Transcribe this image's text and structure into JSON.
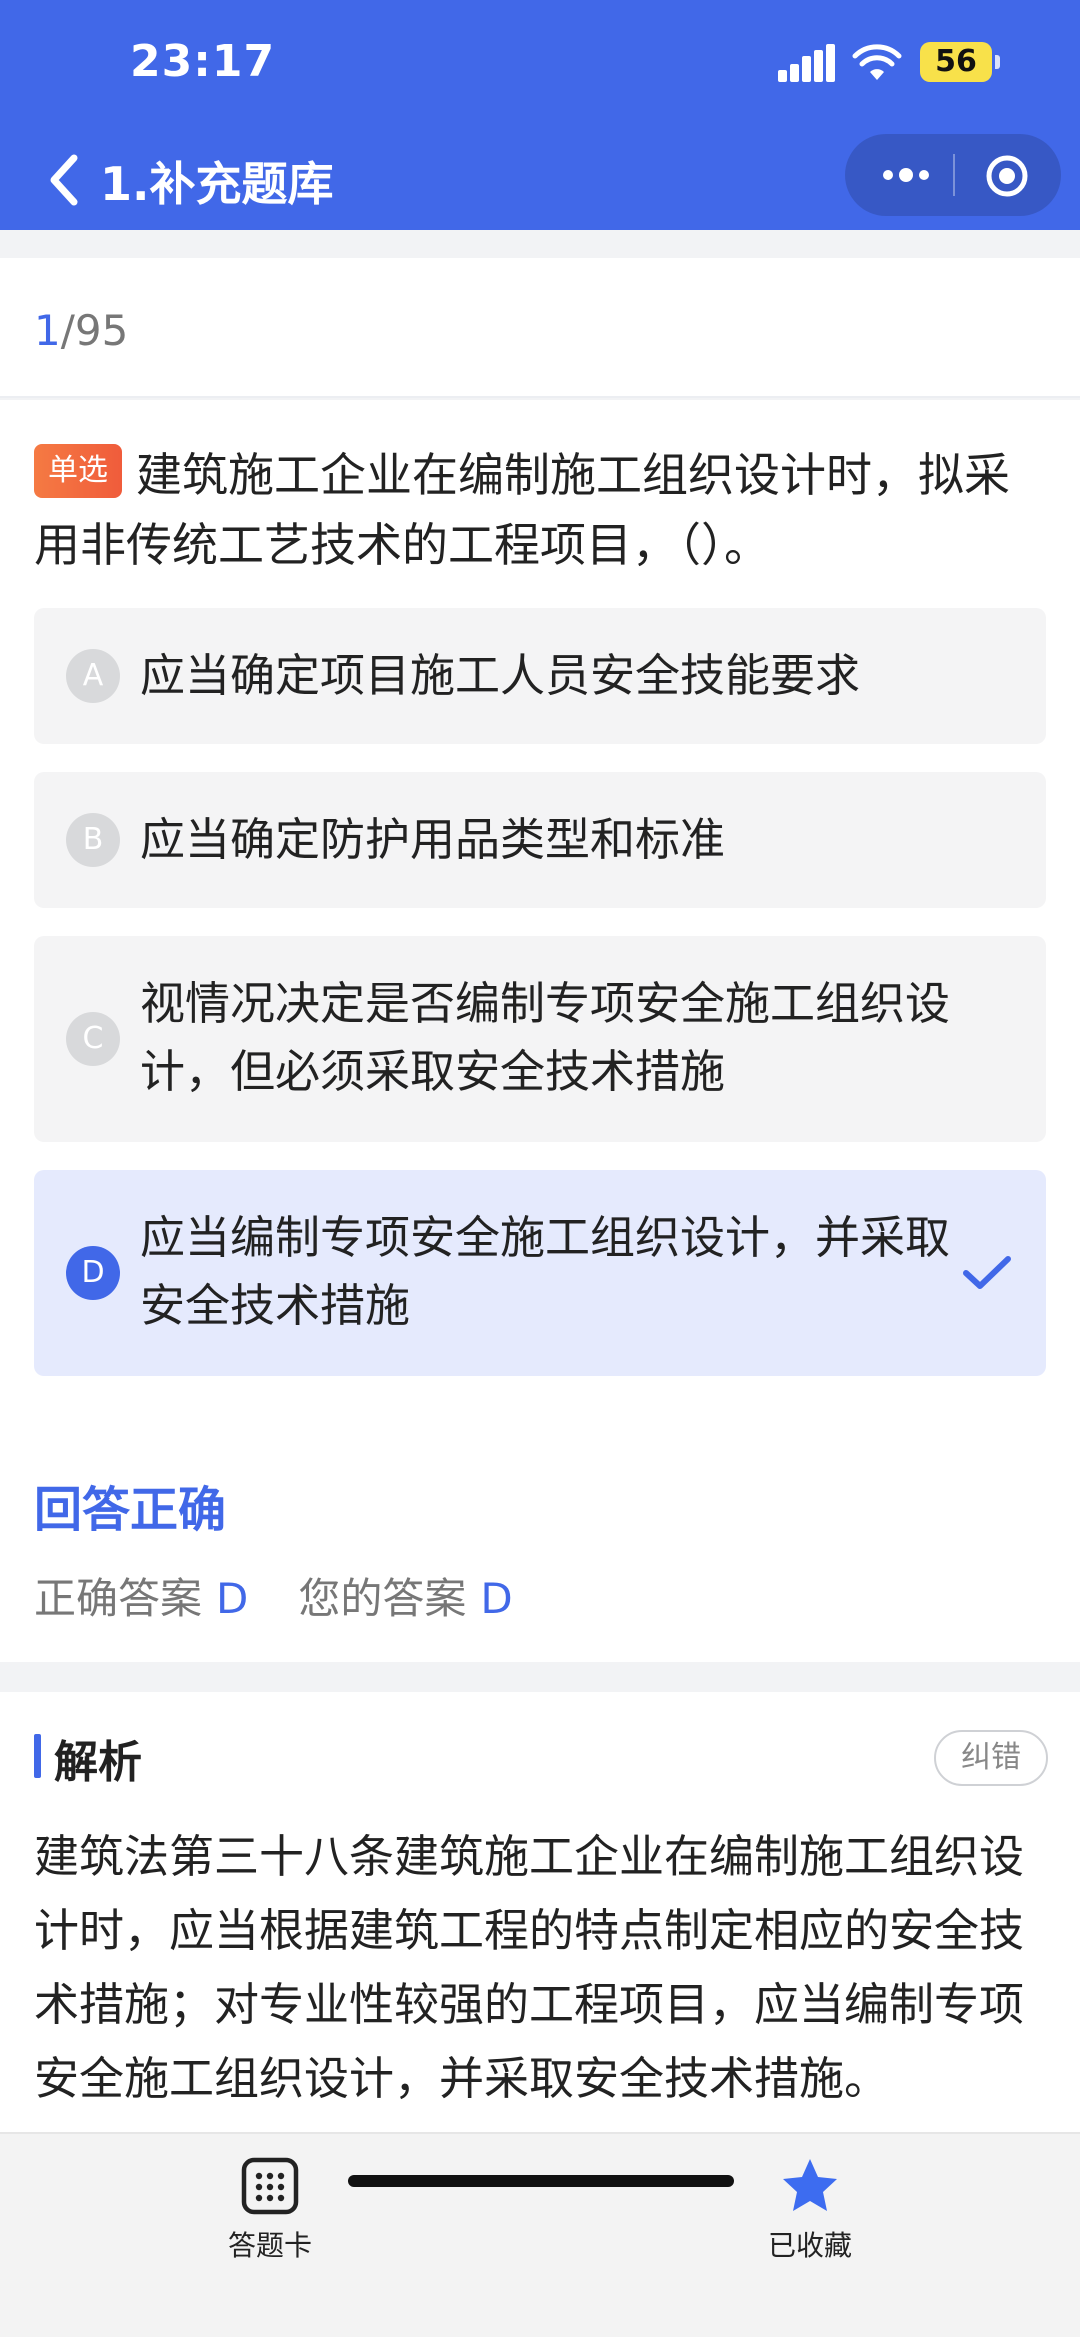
{
  "status_bar": {
    "time": "23:17",
    "battery": "56"
  },
  "nav": {
    "title": "1.补充题库"
  },
  "progress": {
    "current": "1",
    "total": "/95"
  },
  "question": {
    "type_badge": "单选",
    "text": "建筑施工企业在编制施工组织设计时，拟采用非传统工艺技术的工程项目，（）。",
    "options": [
      {
        "letter": "A",
        "text": "应当确定项目施工人员安全技能要求"
      },
      {
        "letter": "B",
        "text": "应当确定防护用品类型和标准"
      },
      {
        "letter": "C",
        "text": "视情况决定是否编制专项安全施工组织设计，但必须采取安全技术措施"
      },
      {
        "letter": "D",
        "text": "应当编制专项安全施工组织设计，并采取安全技术措施"
      }
    ],
    "selected": "D"
  },
  "result": {
    "title": "回答正确",
    "correct_label": "正确答案",
    "correct_value": "D",
    "your_label": "您的答案",
    "your_value": "D"
  },
  "analysis": {
    "title": "解析",
    "report_button": "纠错",
    "text": "建筑法第三十八条建筑施工企业在编制施工组织设计时，应当根据建筑工程的特点制定相应的安全技术措施；对专业性较强的工程项目，应当编制专项安全施工组织设计，并采取安全技术措施。"
  },
  "bottom_bar": {
    "card_label": "答题卡",
    "favorite_label": "已收藏"
  },
  "colors": {
    "accent": "#4168e8",
    "badge": "#f26a3d",
    "selected_bg": "#e5eafd"
  }
}
